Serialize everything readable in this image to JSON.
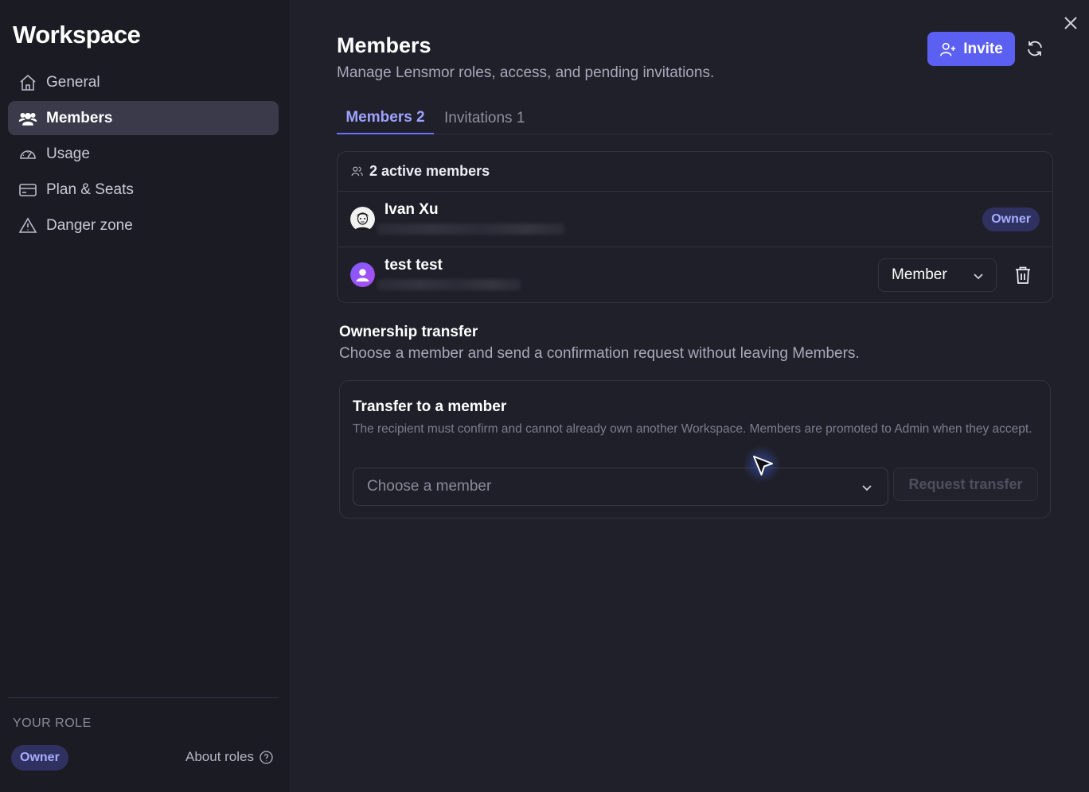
{
  "sidebar": {
    "title": "Workspace",
    "items": [
      {
        "label": "General",
        "icon": "home-icon"
      },
      {
        "label": "Members",
        "icon": "users-icon",
        "active": true
      },
      {
        "label": "Usage",
        "icon": "gauge-icon"
      },
      {
        "label": "Plan & Seats",
        "icon": "credit-card-icon"
      },
      {
        "label": "Danger zone",
        "icon": "warning-icon"
      }
    ],
    "your_role_label": "YOUR ROLE",
    "role": "Owner",
    "about_roles": "About roles"
  },
  "header": {
    "title": "Members",
    "subtitle": "Manage Lensmor roles, access, and pending invitations.",
    "invite_label": "Invite"
  },
  "tabs": [
    {
      "label": "Members 2",
      "active": true
    },
    {
      "label": "Invitations 1",
      "active": false
    }
  ],
  "members_card": {
    "heading": "2 active members",
    "members": [
      {
        "name": "Ivan Xu",
        "badge": "Owner"
      },
      {
        "name": "test test",
        "role": "Member"
      }
    ]
  },
  "ownership": {
    "title": "Ownership transfer",
    "subtitle": "Choose a member and send a confirmation request without leaving Members.",
    "card_title": "Transfer to a member",
    "card_desc": "The recipient must confirm and cannot already own another Workspace. Members are promoted to Admin when they accept.",
    "select_placeholder": "Choose a member",
    "request_label": "Request transfer"
  },
  "colors": {
    "accent": "#5b5ff2",
    "badge_bg": "#2f3160",
    "badge_text": "#a7acff",
    "background": "#20202b",
    "sidebar": "#1b1b24"
  }
}
